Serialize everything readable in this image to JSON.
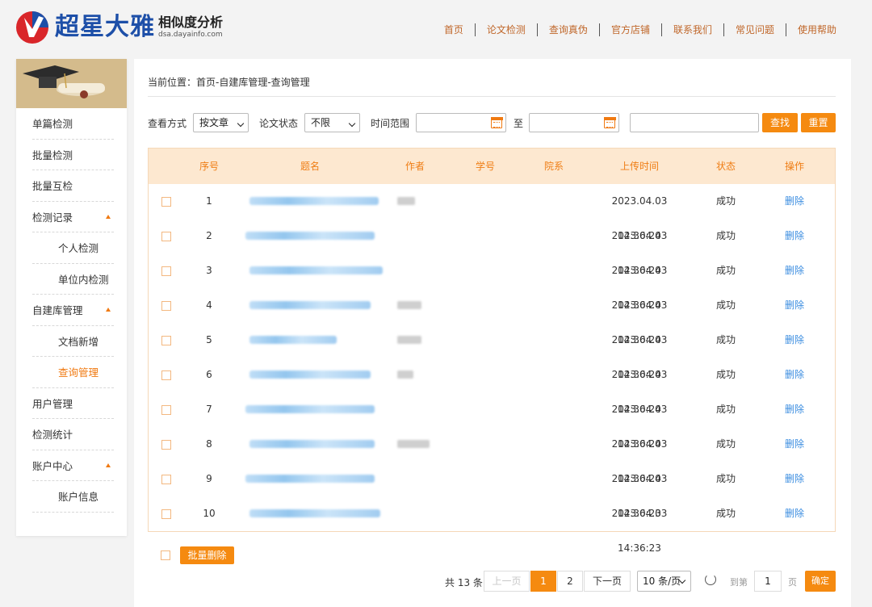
{
  "header": {
    "brand": "超星大雅",
    "subtitle": "相似度分析",
    "url": "dsa.dayainfo.com",
    "nav": [
      "首页",
      "论文检测",
      "查询真伪",
      "官方店铺",
      "联系我们",
      "常见问题",
      "使用帮助"
    ]
  },
  "sidebar": {
    "items": [
      {
        "label": "单篇检测"
      },
      {
        "label": "批量检测"
      },
      {
        "label": "批量互检"
      },
      {
        "label": "检测记录"
      },
      {
        "label": "个人检测"
      },
      {
        "label": "单位内检测"
      },
      {
        "label": "自建库管理"
      },
      {
        "label": "文档新增"
      },
      {
        "label": "查询管理"
      },
      {
        "label": "用户管理"
      },
      {
        "label": "检测统计"
      },
      {
        "label": "账户中心"
      },
      {
        "label": "账户信息"
      }
    ]
  },
  "breadcrumb": "当前位置：首页-自建库管理-查询管理",
  "filters": {
    "view_label": "查看方式",
    "view_value": "按文章",
    "status_label": "论文状态",
    "status_value": "不限",
    "time_label": "时间范围",
    "to_label": "至",
    "search_btn": "查找",
    "reset_btn": "重置"
  },
  "table": {
    "columns": [
      "序号",
      "题名",
      "作者",
      "学号",
      "院系",
      "上传时间",
      "状态",
      "操作"
    ],
    "rows": [
      {
        "no": "1",
        "time": "2023.04.03 14:36:24",
        "status": "成功",
        "action": "删除"
      },
      {
        "no": "2",
        "time": "2023.04.03 14:36:24",
        "status": "成功",
        "action": "删除"
      },
      {
        "no": "3",
        "time": "2023.04.03 14:36:24",
        "status": "成功",
        "action": "删除"
      },
      {
        "no": "4",
        "time": "2023.04.03 14:36:24",
        "status": "成功",
        "action": "删除"
      },
      {
        "no": "5",
        "time": "2023.04.03 14:36:24",
        "status": "成功",
        "action": "删除"
      },
      {
        "no": "6",
        "time": "2023.04.03 14:36:24",
        "status": "成功",
        "action": "删除"
      },
      {
        "no": "7",
        "time": "2023.04.03 14:36:24",
        "status": "成功",
        "action": "删除"
      },
      {
        "no": "8",
        "time": "2023.04.03 14:36:24",
        "status": "成功",
        "action": "删除"
      },
      {
        "no": "9",
        "time": "2023.04.03 14:36:23",
        "status": "成功",
        "action": "删除"
      },
      {
        "no": "10",
        "time": "2023.04.03 14:36:23",
        "status": "成功",
        "action": "删除"
      }
    ]
  },
  "batch_delete": "批量删除",
  "pager": {
    "total": "共 13 条",
    "prev": "上一页",
    "pages": [
      "1",
      "2"
    ],
    "next": "下一页",
    "per_page": "10 条/页",
    "goto": "到第",
    "page_input": "1",
    "page_unit": "页",
    "confirm": "确定"
  },
  "colors": {
    "accent": "#f58a10",
    "header_row": "#fde8d0",
    "link": "#3b8de0",
    "brand": "#1d4fa8"
  }
}
